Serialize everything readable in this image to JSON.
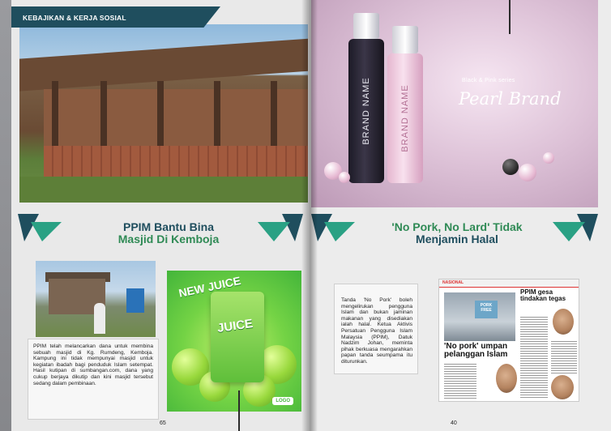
{
  "left_page": {
    "section_tag": "KEBAJIKAN & KERJA SOSIAL",
    "headline_line1": "PPIM Bantu Bina",
    "headline_line2": "Masjid Di Kemboja",
    "body_text": "PPIM telah melancarkan dana untuk membina sebuah masjid di Kg. Rumdeng, Kemboja. Kampung ini tidak mempunyai masjid untuk kegiatan ibadah bagi penduduk Islam setempat. Hasil kutipan di sumbangan.com, dana yang cukup berjaya dikutip dan kini masjid tersebut sedang dalam pembinaan.",
    "page_number": "65",
    "ad": {
      "badge": "NEW JUICE",
      "carton_label": "JUICE",
      "logo": "LOGO"
    }
  },
  "right_page": {
    "ad": {
      "bottle_dark": "BRAND NAME",
      "bottle_pink": "BRAND NAME",
      "series": "Black & Pink series",
      "title": "Pearl Brand"
    },
    "headline_line1": "'No Pork, No Lard' Tidak",
    "headline_line2": "Menjamin Halal",
    "body_text": "Tanda 'No Pork' boleh mengelirukan pengguna Islam dan bukan jaminan makanan yang disediakan ialah halal. Ketua Aktivis Persatuan Pengguna Islam Malaysia (PPIM), Datuk Nadzim Johan, meminta pihak berkuasa mengarahkan papan tanda seumpama itu diturunkan.",
    "page_number": "40",
    "clipping": {
      "section": "NASIONAL",
      "sign_text": "PORK FREE",
      "headline_main": "'No pork' umpan pelanggan Islam",
      "headline_side": "PPIM gesa tindakan tegas"
    }
  },
  "colors": {
    "navy": "#1f4e5e",
    "green": "#2f8a55",
    "teal": "#2aa184"
  }
}
